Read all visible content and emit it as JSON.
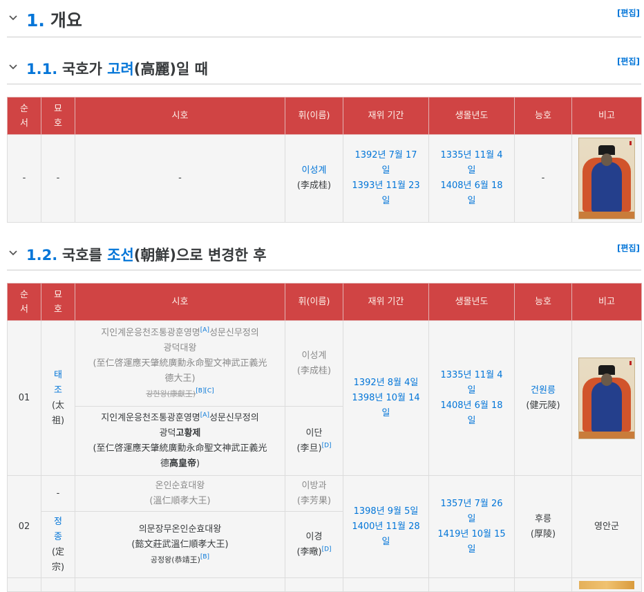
{
  "sections": [
    {
      "num": "1.",
      "title": "개요",
      "edit": "편집"
    },
    {
      "num": "1.1.",
      "title_pre": "국호가 ",
      "title_link": "고려",
      "title_post": "(高麗)일 때",
      "edit": "편집"
    },
    {
      "num": "1.2.",
      "title_pre": "국호를 ",
      "title_link": "조선",
      "title_post": "(朝鮮)으로 변경한 후",
      "edit": "편집"
    }
  ],
  "headers": [
    "순서",
    "묘호",
    "시호",
    "휘(이름)",
    "재위 기간",
    "생몰년도",
    "능호",
    "비고"
  ],
  "header_lines": {
    "order": [
      "순",
      "서"
    ],
    "temple": [
      "묘",
      "호"
    ]
  },
  "goryeo": {
    "order": "-",
    "temple": "-",
    "posthumous": "-",
    "name": "이성계",
    "name_hanja": "(李成桂)",
    "reign": [
      "1392년 7월 17",
      "일",
      "1393년 11월 23",
      "일"
    ],
    "life": [
      "1335년 11월 4",
      "일",
      "1408년 6월 18",
      "일"
    ],
    "tomb": "-"
  },
  "joseon": {
    "r1": {
      "order": "01",
      "temple": [
        "태",
        "조",
        "(太",
        "祖)"
      ],
      "p1": {
        "l1": "지인계운응천조통광훈영명",
        "sup1": "[A]",
        "l1b": "성문신무정의",
        "l2": "광덕대왕",
        "l3": "(至仁啓運應天肇統廣勳永命聖文神武正義光",
        "l4": "德大王)",
        "strike": "강헌왕(康獻王)",
        "sup2": "[B][C]"
      },
      "n1": "이성계",
      "n1_hanja": "(李成桂)",
      "p2": {
        "l1": "지인계운응천조통광훈영명",
        "sup1": "[A]",
        "l1b": "성문신무정의",
        "l2a": "광덕",
        "l2b": "고황제",
        "l3": "(至仁啓運應天肇統廣勳永命聖文神武正義光",
        "l4a": "德",
        "l4b": "高皇帝",
        "l4c": ")"
      },
      "n2": "이단",
      "n2_hanja": "(李旦)",
      "n2_sup": "[D]",
      "reign": [
        "1392년 8월 4일",
        "1398년 10월 14",
        "일"
      ],
      "life": [
        "1335년 11월 4",
        "일",
        "1408년 6월 18",
        "일"
      ],
      "tomb": "건원릉",
      "tomb_hanja": "(健元陵)"
    },
    "r2": {
      "order": "02",
      "temple_a": "-",
      "temple_b": [
        "정",
        "종",
        "(定",
        "宗)"
      ],
      "p1": {
        "l1": "온인순효대왕",
        "l2": "(溫仁順孝大王)"
      },
      "n1": "이방과",
      "n1_hanja": "(李芳果)",
      "p2": {
        "l1": "의문장무온인순효대왕",
        "l2": "(懿文莊武溫仁順孝大王)",
        "l3": "공정왕(恭靖王)",
        "sup": "[B]"
      },
      "n2": "이경",
      "n2_hanja": "(李曔)",
      "n2_sup": "[D]",
      "reign": [
        "1398년 9월 5일",
        "1400년 11월 28",
        "일"
      ],
      "life": [
        "1357년 7월 26",
        "일",
        "1419년 10월 15",
        "일"
      ],
      "tomb": "후릉",
      "tomb_hanja": "(厚陵)",
      "note": "영안군"
    }
  },
  "colors": {
    "header_bg": "#d04444",
    "link": "#0275d8"
  }
}
